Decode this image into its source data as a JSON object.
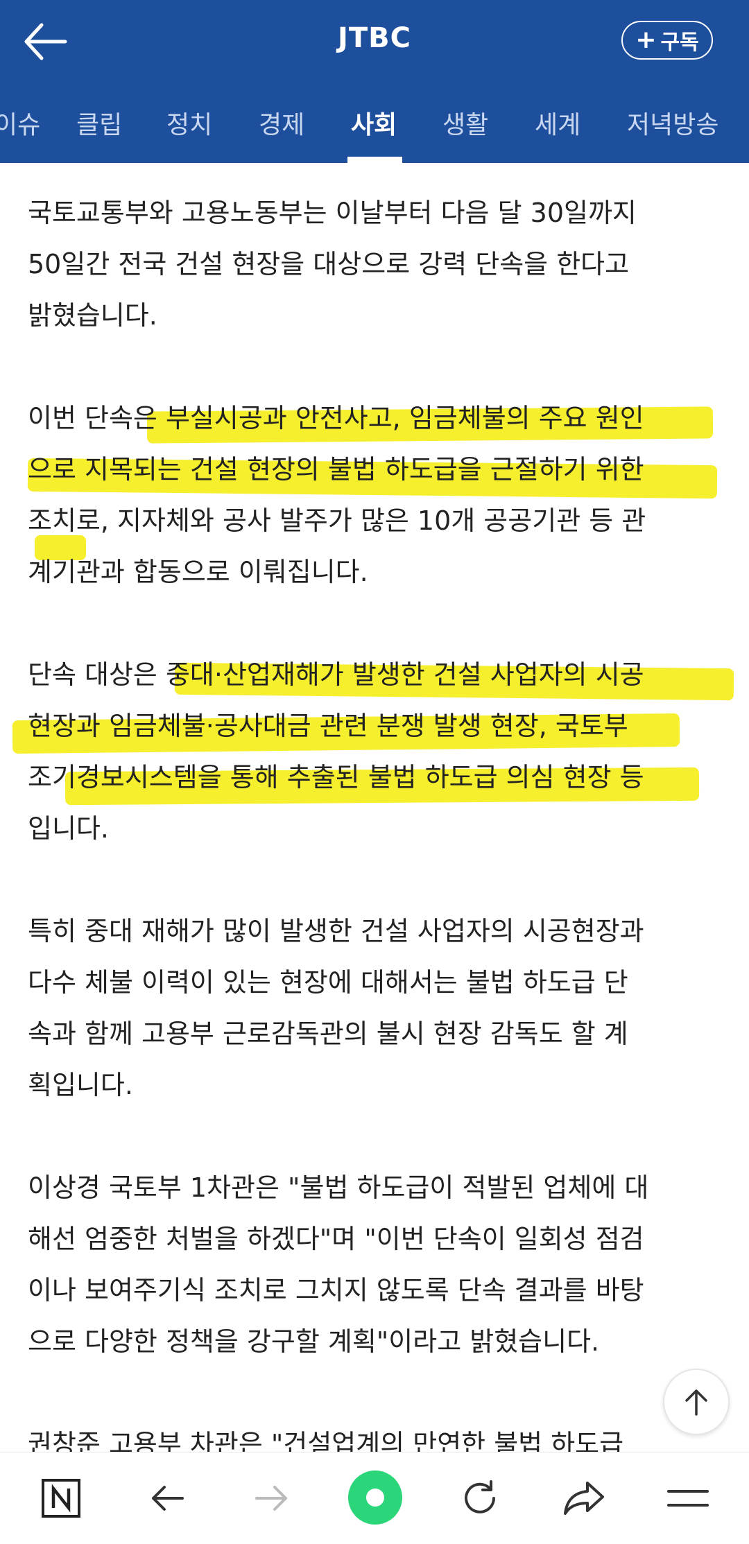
{
  "header": {
    "title": "JTBC",
    "subscribe_label": "구독",
    "subscribe_plus": "+"
  },
  "tabs": [
    {
      "label": "이슈"
    },
    {
      "label": "클립"
    },
    {
      "label": "정치"
    },
    {
      "label": "경제"
    },
    {
      "label": "사회",
      "active": true
    },
    {
      "label": "생활"
    },
    {
      "label": "세계"
    },
    {
      "label": "저녁방송"
    }
  ],
  "article": {
    "paragraphs": [
      "국토교통부와 고용노동부는 이날부터 다음 달 30일까지\n50일간 전국 건설 현장을 대상으로 강력 단속을 한다고\n밝혔습니다.",
      "이번 단속은 부실시공과 안전사고, 임금체불의 주요 원인\n으로 지목되는 건설 현장의 불법 하도급을 근절하기 위한\n조치로, 지자체와 공사 발주가 많은 10개 공공기관 등 관\n계기관과 합동으로 이뤄집니다.",
      "단속 대상은 중대·산업재해가 발생한 건설 사업자의 시공\n현장과 임금체불·공사대금 관련 분쟁 발생 현장, 국토부\n조기경보시스템을 통해 추출된 불법 하도급 의심 현장 등\n입니다.",
      "특히 중대 재해가 많이 발생한 건설 사업자의 시공현장과\n다수 체불 이력이 있는 현장에 대해서는 불법 하도급 단\n속과 함께 고용부 근로감독관의 불시 현장 감독도 할 계\n획입니다.",
      "이상경 국토부 1차관은 \"불법 하도급이 적발된 업체에 대\n해선 엄중한 처벌을 하겠다\"며 \"이번 단속이 일회성 점검\n이나 보여주기식 조치로 그치지 않도록 단속 결과를 바탕\n으로 다양한 정책을 강구할 계획\"이라고 밝혔습니다.",
      "권창준 고용부 차관은 \"건설업계의 만연한 불법 하도급"
    ]
  },
  "colors": {
    "header_bg": "#1e4f9c",
    "highlight": "#f6ee22",
    "text": "#222222"
  },
  "icons": {
    "back": "arrow-left-icon",
    "scroll_top": "arrow-up-icon",
    "bottom": [
      "naver-n-icon",
      "back-arrow-icon",
      "forward-arrow-icon",
      "green-dot-icon",
      "refresh-icon",
      "share-icon",
      "menu-icon"
    ]
  }
}
